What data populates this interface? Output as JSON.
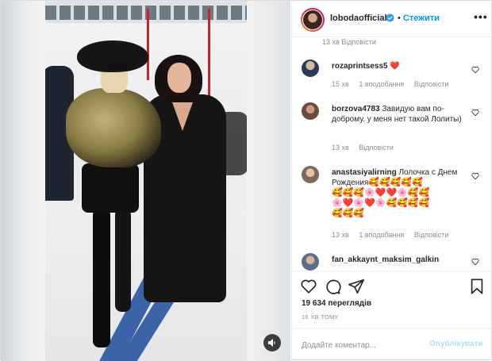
{
  "post": {
    "account": {
      "username": "lobodaofficial",
      "verified": true,
      "follow_separator": "•",
      "follow_label": "Стежити",
      "more_label": "•••"
    },
    "top_partial_meta": "13 хв  Відповісти",
    "comments": [
      {
        "username": "rozaprintsess5",
        "text": "❤️",
        "time": "15 хв",
        "likes": "1 вподобання",
        "reply": "Відповісти"
      },
      {
        "username": "borzova4783",
        "text": "Завидую вам по-доброму. у меня нет такой Лолиты)",
        "time": "13 хв",
        "likes": "",
        "reply": "Відповісти"
      },
      {
        "username": "anastasiyalirning",
        "text": "Лолочка с Днем Рождения",
        "emoji_line1": "🥰🥰🥰🥰🥰",
        "emoji_line2": "🥰🥰🥰🌸❤️❤️🌸🥰🥰",
        "emoji_line3": "🌸❤️🌸❤️🌸🥰🥰🥰🥰",
        "emoji_line4": "🥰🥰🥰",
        "time": "13 хв",
        "likes": "1 вподобання",
        "reply": "Відповісти"
      },
      {
        "username": "fan_akkaynt_maksim_galkin",
        "text": "",
        "time": "",
        "likes": "",
        "reply": ""
      }
    ],
    "views": "19 634 переглядів",
    "time_ago": "16 ХВ ТОМУ",
    "add_comment_placeholder": "Додайте коментар...",
    "publish_label": "Опублікувати",
    "colors": {
      "link_blue": "#0095f6",
      "publish_disabled": "#b2dffc",
      "meta_gray": "#8e8e8e",
      "heart_red": "#ed4956"
    },
    "icons": [
      "like-icon",
      "comment-icon",
      "share-icon",
      "save-icon",
      "sound-icon",
      "heart-icon",
      "verified-icon"
    ]
  }
}
